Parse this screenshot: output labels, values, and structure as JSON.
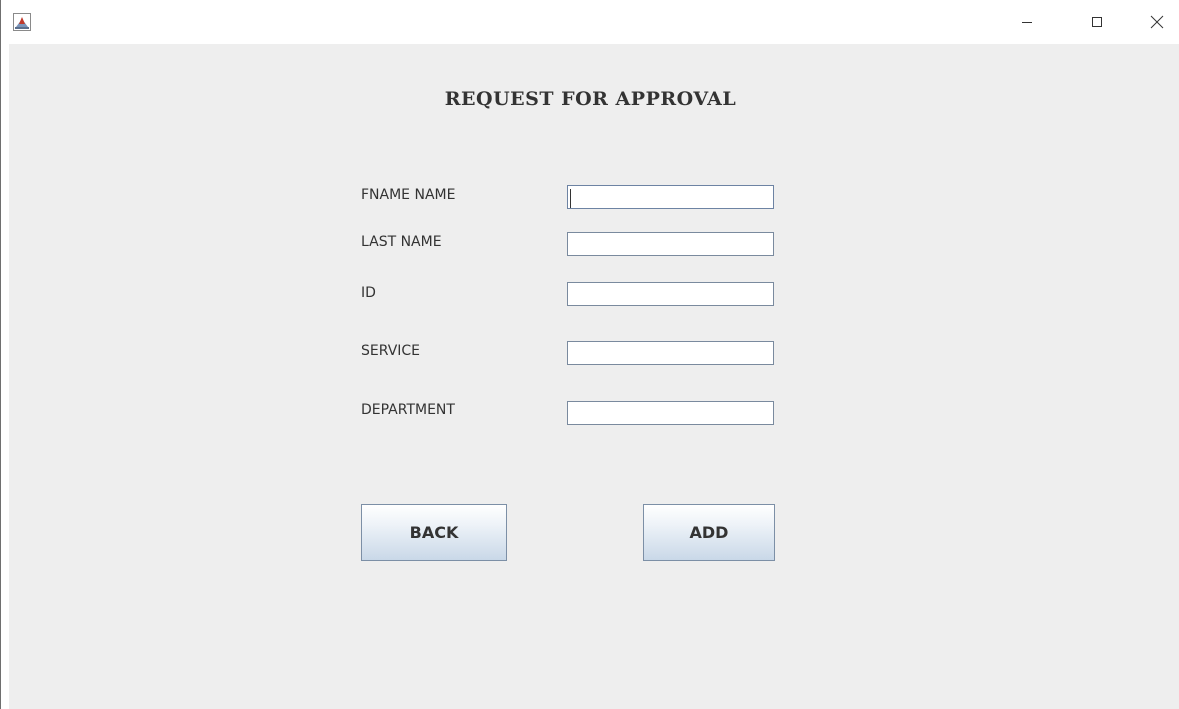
{
  "window": {
    "controls": {
      "minimize_icon": "minimize-icon",
      "maximize_icon": "maximize-icon",
      "close_icon": "close-icon"
    },
    "app_icon": "java-app-icon"
  },
  "form": {
    "title": "REQUEST FOR APPROVAL",
    "fields": [
      {
        "label": "FNAME NAME",
        "value": ""
      },
      {
        "label": "LAST NAME",
        "value": ""
      },
      {
        "label": "ID",
        "value": ""
      },
      {
        "label": "SERVICE",
        "value": ""
      },
      {
        "label": "DEPARTMENT",
        "value": ""
      }
    ],
    "buttons": {
      "back_label": "BACK",
      "add_label": "ADD"
    }
  },
  "colors": {
    "background": "#eeeeee",
    "text": "#333333",
    "input_border": "#7a8a9e",
    "button_gradient_top": "#ffffff",
    "button_gradient_bottom": "#c9d8e8"
  }
}
